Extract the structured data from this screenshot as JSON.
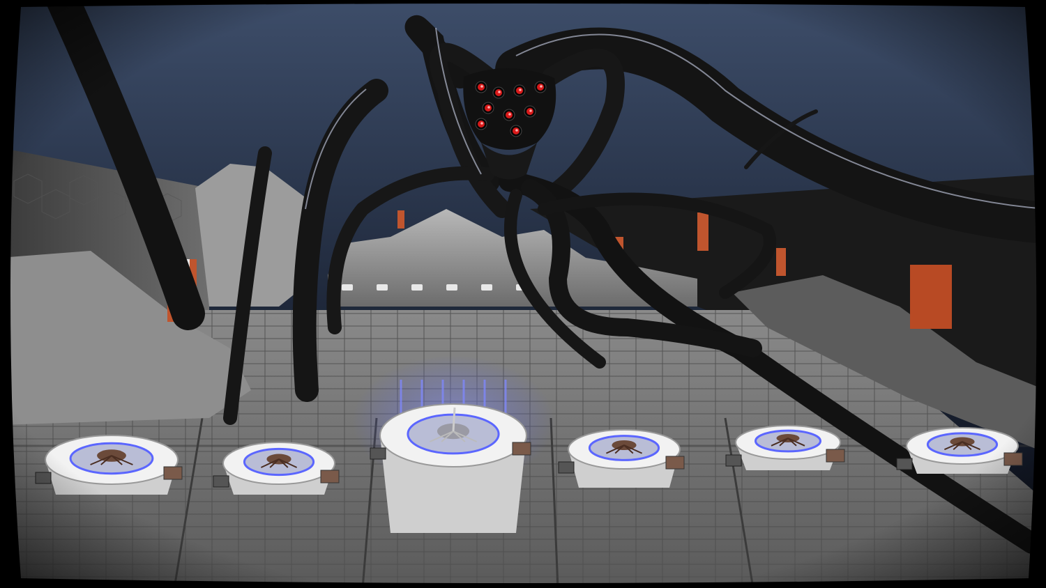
{
  "scene": {
    "name": "tentacle-monster-arena",
    "view": "third-person-overview"
  },
  "palette": {
    "sky_top": "#3a4a66",
    "sky_bottom": "#0d1220",
    "floor": "#6e6e6e",
    "floor_line": "#4a4a4a",
    "wall": "#8c8c8c",
    "tentacle": "#161616",
    "eye_red": "#d81a1a",
    "pillar_accent": "#c0552e",
    "pod_white": "#f2f2f2",
    "pod_glow": "#5b66ff",
    "frame": "#000000"
  },
  "monster": {
    "eye_count": 9
  },
  "pods": [
    {
      "id": "pod-1",
      "selected": false,
      "occupied": true
    },
    {
      "id": "pod-2",
      "selected": false,
      "occupied": true
    },
    {
      "id": "pod-3",
      "selected": true,
      "occupied": true
    },
    {
      "id": "pod-4",
      "selected": false,
      "occupied": true
    },
    {
      "id": "pod-5",
      "selected": false,
      "occupied": true
    },
    {
      "id": "pod-6",
      "selected": false,
      "occupied": true
    }
  ]
}
